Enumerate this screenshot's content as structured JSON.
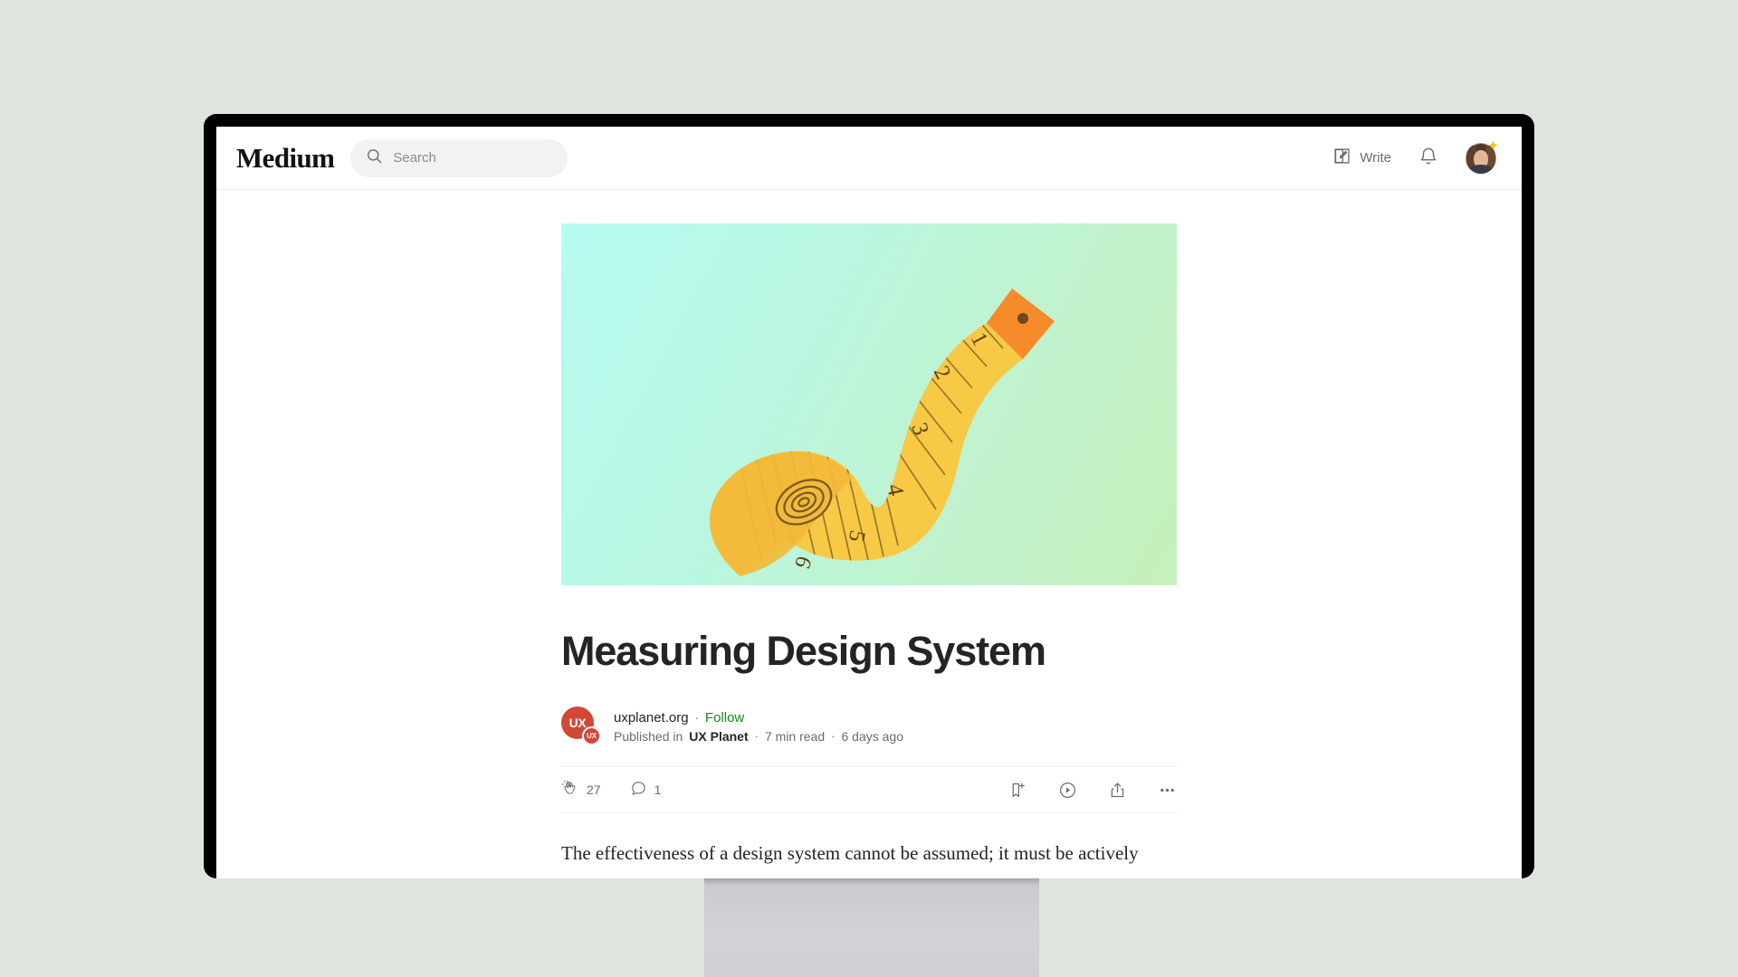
{
  "page": {
    "background_color": "#dfe4de",
    "device": "desktop-monitor"
  },
  "header": {
    "logo": "Medium",
    "search": {
      "placeholder": "Search",
      "value": "",
      "icon": "search-icon"
    },
    "write_label": "Write",
    "write_icon": "pencil-square-icon",
    "notifications_icon": "bell-icon",
    "avatar": {
      "name": "user-avatar",
      "badge_icon": "sparkle-star-icon",
      "badge_color": "#ffc400"
    }
  },
  "article": {
    "hero": {
      "alt": "Illustration of a curled yellow measuring tape",
      "gradient_start": "#b6fbf1",
      "gradient_end": "#c6f0bb",
      "tape_color": "#f5c63f",
      "tape_shadow_color": "#e8a93a",
      "tape_tip_color": "#f58b2c",
      "tick_numbers": [
        "1",
        "2",
        "3",
        "4",
        "5",
        "6"
      ]
    },
    "title": "Measuring Design System",
    "byline": {
      "publication_logo_text": "UX",
      "publication_logo_small_text": "UX",
      "publication_logo_color": "#d14836",
      "author": "uxplanet.org",
      "separator": "·",
      "follow_label": "Follow",
      "follow_color": "#1a8917",
      "published_in_prefix": "Published in",
      "publication": "UX Planet",
      "read_time": "7 min read",
      "date": "6 days ago"
    },
    "engagement": {
      "clap_icon": "clap-icon",
      "clap_count": "27",
      "comment_icon": "comment-icon",
      "comment_count": "1",
      "bookmark_icon": "bookmark-plus-icon",
      "listen_icon": "play-circle-icon",
      "share_icon": "share-icon",
      "more_icon": "ellipsis-icon"
    },
    "body_first_line": "The effectiveness of a design system cannot be assumed; it must be actively"
  }
}
